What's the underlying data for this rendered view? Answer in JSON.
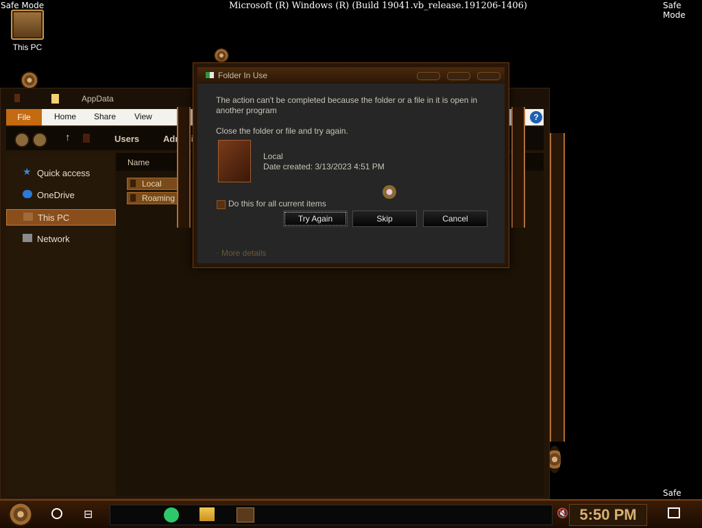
{
  "desktop": {
    "safe_mode_tl": "Safe Mode",
    "safe_mode_tr": "Safe Mode",
    "safe_mode_br": "Safe Mode",
    "build": "Microsoft (R) Windows (R) (Build 19041.vb_release.191206-1406)",
    "icon_label": "This PC"
  },
  "explorer": {
    "title": "AppData",
    "ribbon": {
      "file": "File",
      "home": "Home",
      "share": "Share",
      "view": "View"
    },
    "breadcrumb": {
      "users": "Users",
      "admin": "Adminis"
    },
    "sidebar": [
      {
        "label": "Quick access",
        "icon": "star-icon"
      },
      {
        "label": "OneDrive",
        "icon": "cloud-icon"
      },
      {
        "label": "This PC",
        "icon": "computer-icon"
      },
      {
        "label": "Network",
        "icon": "network-icon"
      }
    ],
    "column_name": "Name",
    "folders": [
      "Local",
      "Roaming"
    ]
  },
  "dialog": {
    "title": "Folder In Use",
    "message": "The action can't be completed because the folder or a file in it is open in another program",
    "instruction": "Close the folder or file and try again.",
    "item_name": "Local",
    "item_date": "Date created: 3/13/2023 4:51 PM",
    "checkbox_label": "Do this for all current items",
    "try_again": "Try Again",
    "skip": "Skip",
    "cancel": "Cancel",
    "more_details": "More details"
  },
  "taskbar": {
    "clock": "5:50 PM"
  },
  "colors": {
    "accent": "#c46a10",
    "dialog_bg": "#262626",
    "clock_text": "#d8b070"
  }
}
